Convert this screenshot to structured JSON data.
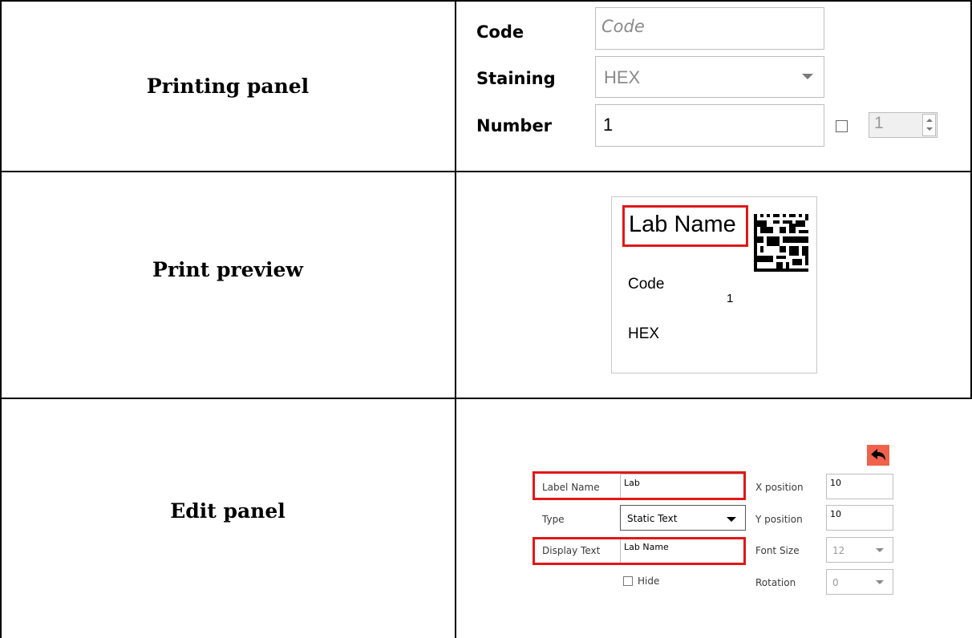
{
  "rows": {
    "printing_panel": "Printing panel",
    "print_preview": "Print preview",
    "edit_panel": "Edit panel"
  },
  "printing_panel": {
    "code_label": "Code",
    "code_placeholder": "Code",
    "staining_label": "Staining",
    "staining_value": "HEX",
    "number_label": "Number",
    "number_value": "1",
    "copies_value": "1"
  },
  "preview": {
    "lab_name": "Lab Name",
    "code": "Code",
    "number": "1",
    "staining": "HEX"
  },
  "edit_panel": {
    "label_name_label": "Label Name",
    "label_name_value": "Lab",
    "type_label": "Type",
    "type_value": "Static Text",
    "display_text_label": "Display Text",
    "display_text_value": "Lab Name",
    "hide_label": "Hide",
    "x_position_label": "X position",
    "x_position_value": "10",
    "y_position_label": "Y position",
    "y_position_value": "10",
    "font_size_label": "Font Size",
    "font_size_value": "12",
    "rotation_label": "Rotation",
    "rotation_value": "0"
  },
  "colors": {
    "highlight": "#e01818",
    "back_button": "#f0624c"
  },
  "icons": {
    "back": "back-arrow-icon",
    "barcode": "datamatrix-barcode-icon"
  }
}
